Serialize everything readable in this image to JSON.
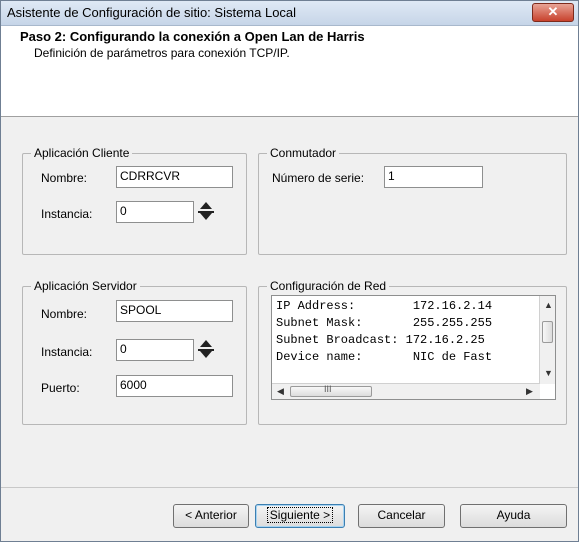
{
  "window": {
    "title": "Asistente de Configuración de sitio: Sistema Local",
    "close_glyph": "✕"
  },
  "header": {
    "step_title": "Paso 2: Configurando la conexión a Open Lan de Harris",
    "step_subtitle": "Definición de parámetros para conexión TCP/IP."
  },
  "client_app": {
    "legend": "Aplicación Cliente",
    "name_label": "Nombre:",
    "name_value": "CDRRCVR",
    "instance_label": "Instancia:",
    "instance_value": "0"
  },
  "switch": {
    "legend": "Conmutador",
    "serial_label": "Número de serie:",
    "serial_value": "1"
  },
  "server_app": {
    "legend": "Aplicación Servidor",
    "name_label": "Nombre:",
    "name_value": "SPOOL",
    "instance_label": "Instancia:",
    "instance_value": "0",
    "port_label": "Puerto:",
    "port_value": "6000"
  },
  "network": {
    "legend": "Configuración de Red",
    "rows": [
      "IP Address:        172.16.2.14",
      "Subnet Mask:       255.255.255",
      "Subnet Broadcast: 172.16.2.25",
      "Device name:       NIC de Fast"
    ],
    "hscroll_thumb_glyph": "III"
  },
  "buttons": {
    "back": "< Anterior",
    "next": "Siguiente >",
    "cancel": "Cancelar",
    "help": "Ayuda"
  }
}
